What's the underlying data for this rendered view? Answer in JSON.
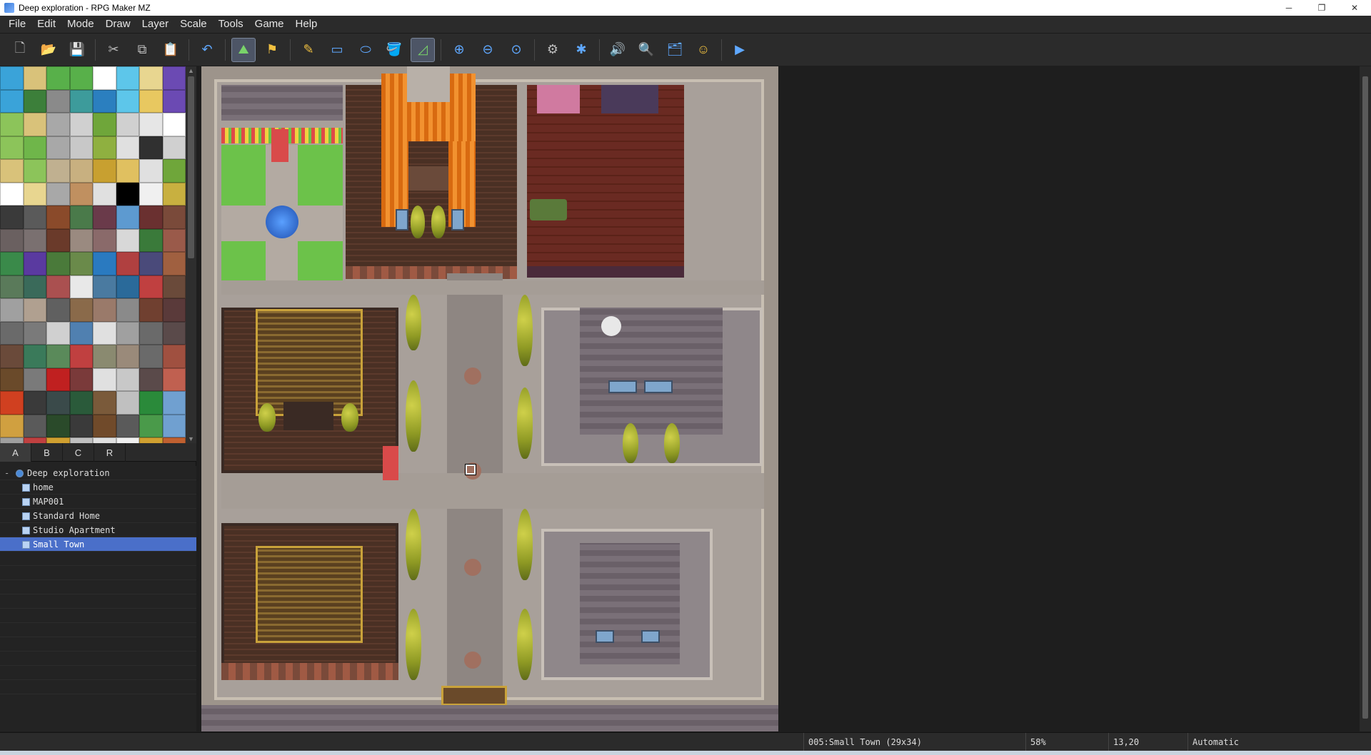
{
  "window": {
    "title": "Deep exploration - RPG Maker MZ",
    "controls": {
      "minimize": "─",
      "maximize": "❐",
      "close": "✕"
    }
  },
  "menu": [
    "File",
    "Edit",
    "Mode",
    "Draw",
    "Layer",
    "Scale",
    "Tools",
    "Game",
    "Help"
  ],
  "toolbar": {
    "icons": [
      "new-project-icon",
      "open-project-icon",
      "save-project-icon",
      "cut-icon",
      "copy-icon",
      "paste-icon",
      "undo-icon",
      "map-mode-icon",
      "event-mode-icon",
      "pencil-icon",
      "rectangle-icon",
      "ellipse-icon",
      "flood-fill-icon",
      "shadow-pen-icon",
      "zoom-in-icon",
      "zoom-out-icon",
      "actual-size-icon",
      "database-icon",
      "plugin-manager-icon",
      "sound-test-icon",
      "event-searcher-icon",
      "resource-manager-icon",
      "character-generator-icon",
      "playtest-icon"
    ],
    "active": [
      "map-mode-icon",
      "shadow-pen-icon"
    ]
  },
  "tileset": {
    "tabs": [
      "A",
      "B",
      "C",
      "R"
    ],
    "active_tab": "A",
    "colors": [
      "#3aa3d9",
      "#d9c27a",
      "#58b04a",
      "#58b04a",
      "#ffffff",
      "#5dc6ea",
      "#e8d690",
      "#6b4ab3",
      "#3aa3d9",
      "#3c7f3a",
      "#8a8a8a",
      "#3d9b9b",
      "#2b7fbf",
      "#5dc6ea",
      "#e8c860",
      "#6b4ab3",
      "#8cc45a",
      "#d9c27a",
      "#a8a8a8",
      "#d0d0d0",
      "#6fa63a",
      "#d0d0d0",
      "#e6e6e6",
      "#ffffff",
      "#8cc45a",
      "#6fb64a",
      "#a8a8a8",
      "#c8c8c8",
      "#8fb040",
      "#e0e0e0",
      "#303030",
      "#d0d0d0",
      "#d9c27a",
      "#8cc45a",
      "#c0b090",
      "#c8b080",
      "#c8a030",
      "#e0c060",
      "#e0e0e0",
      "#6fa63a",
      "#ffffff",
      "#e8d690",
      "#a8a8a8",
      "#c09060",
      "#e0e0e0",
      "#000000",
      "#f0f0f0",
      "#c8b040",
      "#3a3a3a",
      "#5a5a5a",
      "#8a4a2a",
      "#4a7a4a",
      "#6a3a4a",
      "#5d9ad0",
      "#6a3030",
      "#7a4a3a",
      "#6a6060",
      "#7a7070",
      "#6a3a2a",
      "#9a8a80",
      "#8a6a6a",
      "#d8d8d8",
      "#3a7a3a",
      "#9a5a4a",
      "#3a8a4a",
      "#5a3aa0",
      "#4a7a3a",
      "#6a8a4a",
      "#2a7ac0",
      "#b04040",
      "#4a4a7a",
      "#a06040",
      "#5a7a5a",
      "#3a6a5a",
      "#aa5050",
      "#e8e8e8",
      "#4a7aa0",
      "#2a6a9a",
      "#c04040",
      "#6a4a3a",
      "#a0a0a0",
      "#b0a090",
      "#606060",
      "#8a6a4a",
      "#9a7a6a",
      "#8a8a8a",
      "#704030",
      "#5a3a3a",
      "#6a6a6a",
      "#7a7a7a",
      "#d0d0d0",
      "#5080b0",
      "#e0e0e0",
      "#a0a0a0",
      "#6a6a6a",
      "#5a4a4a",
      "#6a4a3a",
      "#3a7a5a",
      "#5a8a5a",
      "#c04040",
      "#8a8a70",
      "#9a8a7a",
      "#6a6a6a",
      "#a05040",
      "#6a4a2a",
      "#7a7a7a",
      "#c02020",
      "#7a3a3a",
      "#e0e0e0",
      "#c8c8c8",
      "#5a4a4a",
      "#c06050",
      "#d04020",
      "#3a3a3a",
      "#3a4a4a",
      "#2a5a3a",
      "#7a5a3a",
      "#c0c0c0",
      "#2a8a3a",
      "#70a0d0",
      "#d0a040",
      "#5a5a5a",
      "#2a4a2a",
      "#3a3a3a",
      "#704a2a",
      "#5a5a5a",
      "#4a9a4a",
      "#70a0d0",
      "#a0a0a0",
      "#c04040",
      "#d0a030",
      "#c0c0c0",
      "#e0e0e0",
      "#f0f0f0",
      "#d0a030",
      "#c06030"
    ]
  },
  "map_tree": {
    "project": "Deep exploration",
    "maps": [
      "home",
      "MAP001",
      "Standard Home",
      "Studio Apartment",
      "Small Town"
    ],
    "selected": "Small Town"
  },
  "status": {
    "map_info": "005:Small Town (29x34)",
    "zoom": "58%",
    "coords": "13,20",
    "mode": "Automatic"
  }
}
